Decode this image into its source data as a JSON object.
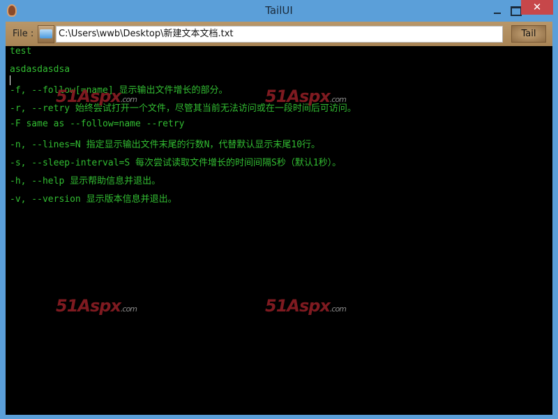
{
  "window": {
    "title": "TailUI",
    "close_glyph": "✕"
  },
  "toolbar": {
    "file_label": "File :",
    "path": "C:\\Users\\wwb\\Desktop\\新建文本文档.txt",
    "tail_label": "Tail"
  },
  "console": {
    "lines": [
      "test",
      "asdasdasdsa",
      "-f, --follow[=name] 显示输出文件增长的部分。",
      "-r, --retry 始终尝试打开一个文件，尽管其当前无法访问或在一段时间后可访问。",
      "-F same as --follow=name --retry",
      "-n, --lines=N 指定显示输出文件末尾的行数N，代替默认显示末尾10行。",
      "-s, --sleep-interval=S 每次尝试读取文件增长的时间间隔S秒（默认1秒）。",
      "-h, --help 显示帮助信息并退出。",
      "-v, --version 显示版本信息并退出。"
    ]
  },
  "watermark": {
    "main": "51Aspx",
    "suffix": ".com"
  }
}
